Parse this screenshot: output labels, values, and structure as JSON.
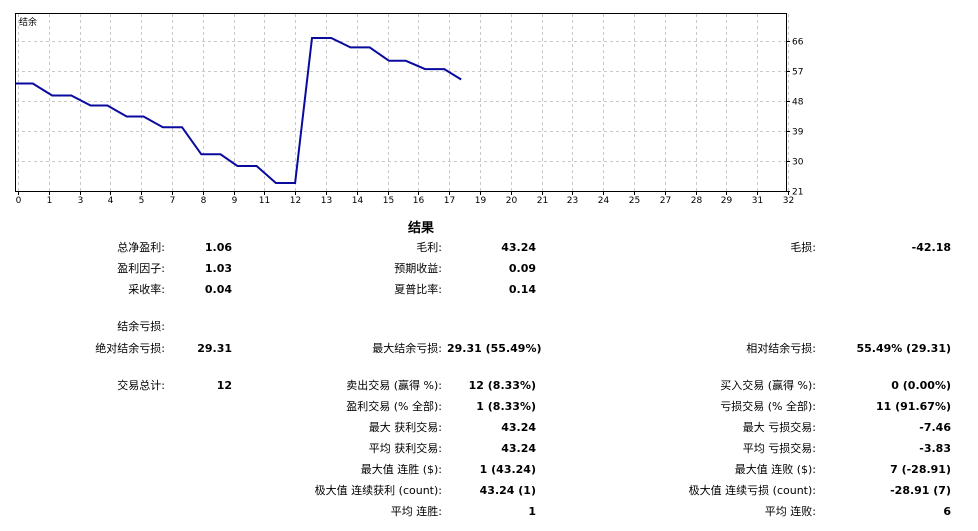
{
  "chart_data": {
    "type": "line",
    "title": "结余",
    "xlim": [
      0,
      32
    ],
    "ylim": [
      21,
      74
    ],
    "x_ticks": [
      "0",
      "1",
      "3",
      "4",
      "5",
      "7",
      "8",
      "9",
      "11",
      "12",
      "13",
      "14",
      "15",
      "16",
      "17",
      "19",
      "20",
      "21",
      "23",
      "24",
      "25",
      "27",
      "28",
      "29",
      "31",
      "32"
    ],
    "y_ticks": [
      "66",
      "57",
      "48",
      "39",
      "30",
      "21"
    ],
    "y_tick_values": [
      66,
      57,
      48,
      39,
      30,
      21
    ],
    "series": [
      {
        "color": "#0a0a9e",
        "points": [
          [
            0,
            53.2
          ],
          [
            0.7,
            53.2
          ],
          [
            1.5,
            49.6
          ],
          [
            2.3,
            49.6
          ],
          [
            3.1,
            46.6
          ],
          [
            3.8,
            46.6
          ],
          [
            4.6,
            43.3
          ],
          [
            5.3,
            43.3
          ],
          [
            6.1,
            40.1
          ],
          [
            6.9,
            40.1
          ],
          [
            7.7,
            32.0
          ],
          [
            8.5,
            32.0
          ],
          [
            9.2,
            28.5
          ],
          [
            10.0,
            28.5
          ],
          [
            10.8,
            23.4
          ],
          [
            11.6,
            23.4
          ],
          [
            12.3,
            66.8
          ],
          [
            13.1,
            66.8
          ],
          [
            13.9,
            64.0
          ],
          [
            14.7,
            64.0
          ],
          [
            15.5,
            60.0
          ],
          [
            16.2,
            60.0
          ],
          [
            17.0,
            57.5
          ],
          [
            17.8,
            57.5
          ],
          [
            18.5,
            54.4
          ]
        ]
      }
    ],
    "grid": true,
    "colors": {
      "line": "#0a0a9e",
      "grid": "#c8c8c8",
      "frame": "#000000"
    }
  },
  "results_title": "结果",
  "stats": {
    "net_profit_label": "总净盈利:",
    "net_profit": "1.06",
    "gross_profit_label": "毛利:",
    "gross_profit": "43.24",
    "gross_loss_label": "毛损:",
    "gross_loss": "-42.18",
    "profit_factor_label": "盈利因子:",
    "profit_factor": "1.03",
    "expected_payoff_label": "预期收益:",
    "expected_payoff": "0.09",
    "recovery_label": "采收率:",
    "recovery": "0.04",
    "sharpe_label": "夏普比率:",
    "sharpe": "0.14",
    "balance_dd_label": "结余亏损:",
    "abs_dd_label": "绝对结余亏损:",
    "abs_dd": "29.31",
    "max_dd_label": "最大结余亏损:",
    "max_dd": "29.31 (55.49%)",
    "rel_dd_label": "相对结余亏损:",
    "rel_dd": "55.49% (29.31)",
    "total_trades_label": "交易总计:",
    "total_trades": "12",
    "short_label": "卖出交易 (赢得 %):",
    "short": "12 (8.33%)",
    "long_label": "买入交易 (赢得 %):",
    "long": "0 (0.00%)",
    "profit_trades_label": "盈利交易 (% 全部):",
    "profit_trades": "1 (8.33%)",
    "loss_trades_label": "亏损交易 (% 全部):",
    "loss_trades": "11 (91.67%)",
    "largest_profit_label": "最大 获利交易:",
    "largest_profit": "43.24",
    "largest_loss_label": "最大 亏损交易:",
    "largest_loss": "-7.46",
    "avg_profit_label": "平均 获利交易:",
    "avg_profit": "43.24",
    "avg_loss_label": "平均 亏损交易:",
    "avg_loss": "-3.83",
    "max_cons_wins_label": "最大值 连胜 ($):",
    "max_cons_wins": "1 (43.24)",
    "max_cons_losses_label": "最大值 连败 ($):",
    "max_cons_losses": "7 (-28.91)",
    "max_cons_profit_label": "极大值 连续获利 (count):",
    "max_cons_profit": "43.24 (1)",
    "max_cons_loss_label": "极大值 连续亏损 (count):",
    "max_cons_loss": "-28.91 (7)",
    "avg_cons_wins_label": "平均 连胜:",
    "avg_cons_wins": "1",
    "avg_cons_losses_label": "平均 连败:",
    "avg_cons_losses": "6"
  }
}
